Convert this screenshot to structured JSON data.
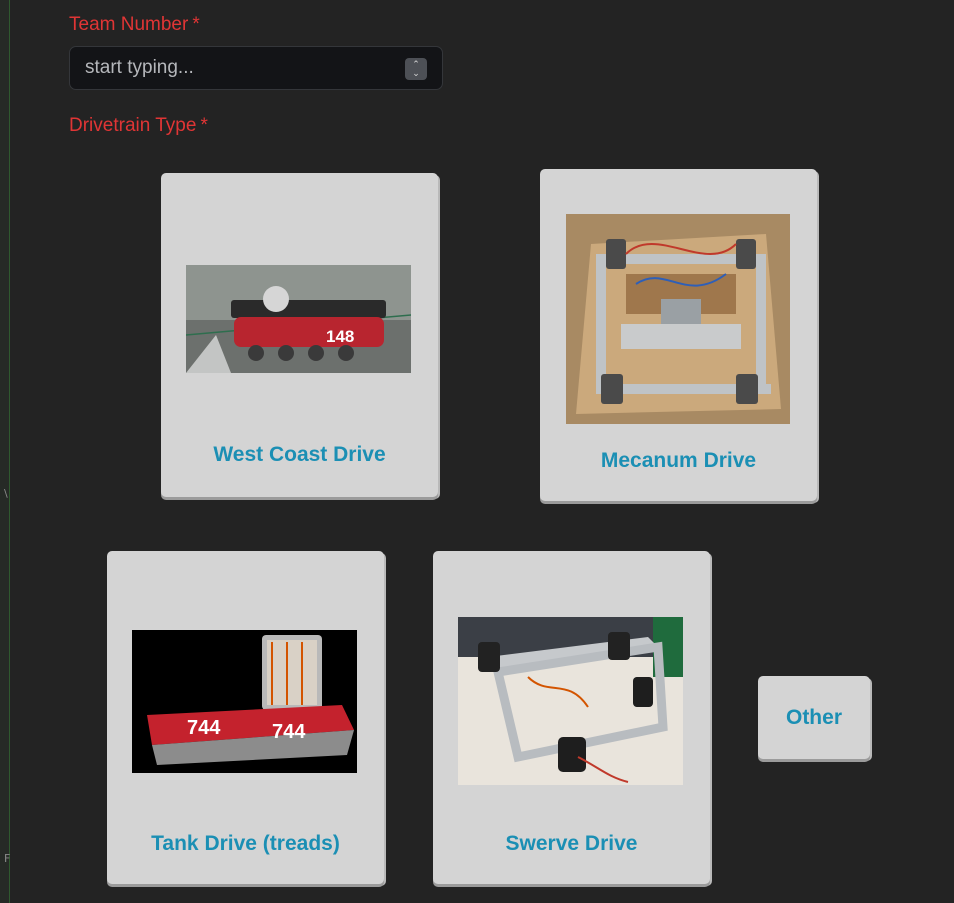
{
  "form": {
    "team_number": {
      "label": "Team Number",
      "required_mark": "*",
      "placeholder": "start typing...",
      "value": ""
    },
    "drivetrain": {
      "label": "Drivetrain Type",
      "required_mark": "*",
      "options": [
        {
          "label": "West Coast Drive",
          "robot_number": "148"
        },
        {
          "label": "Mecanum Drive"
        },
        {
          "label": "Tank Drive (treads)",
          "robot_number": "744"
        },
        {
          "label": "Swerve Drive"
        },
        {
          "label": "Other"
        }
      ]
    }
  },
  "colors": {
    "background": "#232323",
    "label_red": "#e03535",
    "card_bg": "#d4d4d4",
    "card_text": "#1b8fb4"
  }
}
